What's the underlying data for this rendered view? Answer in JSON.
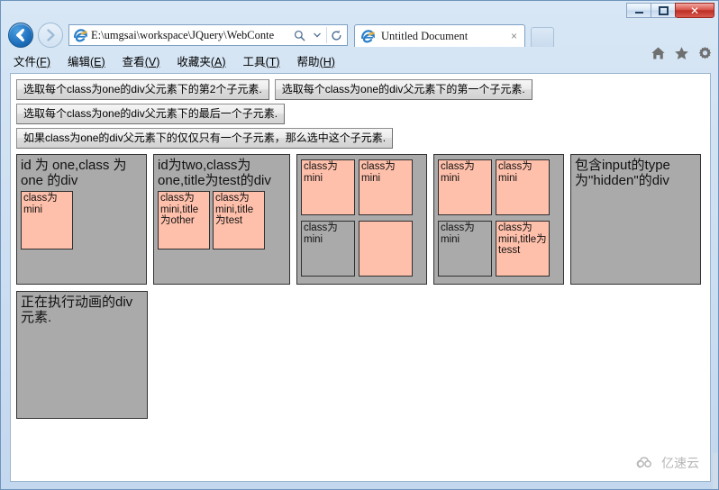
{
  "window": {
    "controls": {
      "minimize_label": "minimize",
      "maximize_label": "maximize",
      "close_label": "✕"
    }
  },
  "browser": {
    "address": {
      "url": "E:\\umgsai\\workspace\\JQuery\\WebConte",
      "search_icon": "search-icon",
      "dropdown_icon": "chevron-down-icon",
      "refresh_icon": "refresh-icon"
    },
    "tab": {
      "title": "Untitled Document",
      "close_label": "×"
    },
    "tool_icons": [
      "home-icon",
      "favorites-star-icon",
      "settings-gear-icon"
    ],
    "menu": [
      {
        "label": "文件",
        "mnemonic": "(F)"
      },
      {
        "label": "编辑",
        "mnemonic": "(E)"
      },
      {
        "label": "查看",
        "mnemonic": "(V)"
      },
      {
        "label": "收藏夹",
        "mnemonic": "(A)"
      },
      {
        "label": "工具",
        "mnemonic": "(T)"
      },
      {
        "label": "帮助",
        "mnemonic": "(H)"
      }
    ]
  },
  "page": {
    "buttons": [
      {
        "label": "选取每个class为one的div父元素下的第2个子元素."
      },
      {
        "label": "选取每个class为one的div父元素下的第一个子元素."
      },
      {
        "label": "选取每个class为one的div父元素下的最后一个子元素."
      },
      {
        "label": "如果class为one的div父元素下的仅仅只有一个子元素，那么选中这个子元素."
      }
    ],
    "colors": {
      "parent_bg": "#aaaaaa",
      "child_highlight": "#ffc0ab",
      "border": "#333333"
    },
    "divs": [
      {
        "label": "id 为 one,class 为 one 的div",
        "children": [
          {
            "label": "class为mini",
            "highlighted": true
          }
        ]
      },
      {
        "label": "id为two,class为one,title为test的div",
        "children": [
          {
            "label": "class为mini,title为other",
            "highlighted": true
          },
          {
            "label": "class为mini,title为test",
            "highlighted": true
          }
        ]
      },
      {
        "label": "",
        "children": [
          {
            "label": "class为mini",
            "highlighted": true
          },
          {
            "label": "class为mini",
            "highlighted": true
          },
          {
            "label": "class为mini",
            "highlighted": false
          },
          {
            "label": "",
            "highlighted": true
          }
        ]
      },
      {
        "label": "",
        "children": [
          {
            "label": "class为mini",
            "highlighted": true
          },
          {
            "label": "class为mini",
            "highlighted": true
          },
          {
            "label": "class为mini",
            "highlighted": false
          },
          {
            "label": "class为mini,title为tesst",
            "highlighted": true
          }
        ]
      },
      {
        "label": "包含input的type为\"hidden\"的div",
        "children": []
      }
    ],
    "lower_div": {
      "label": "正在执行动画的div元素."
    }
  },
  "watermark": {
    "text": "亿速云",
    "icon": "cloud-icon"
  }
}
